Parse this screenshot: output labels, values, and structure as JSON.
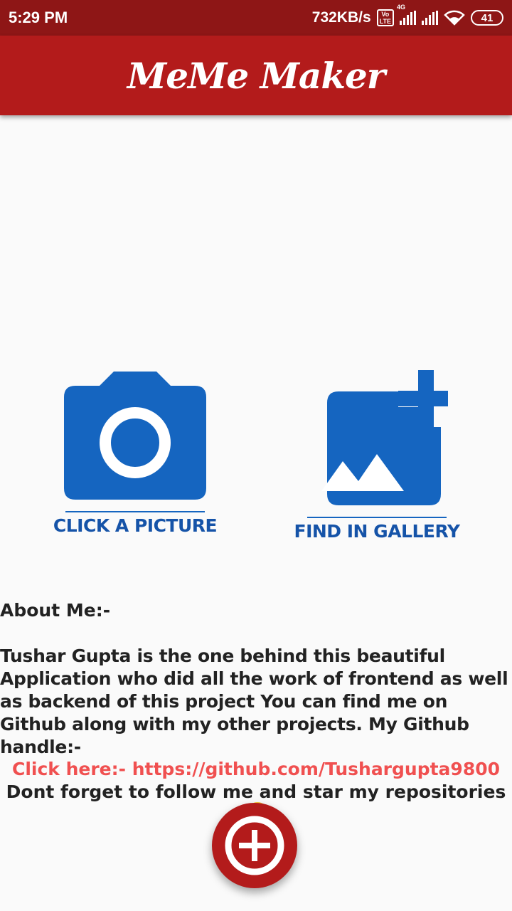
{
  "status_bar": {
    "time": "5:29 PM",
    "network_speed": "732KB/s",
    "volte_label": "Vo LTE",
    "network_type": "4G",
    "battery_level": "41"
  },
  "app_bar": {
    "title": "MeMe Maker"
  },
  "actions": {
    "camera_label": "CLICK A PICTURE",
    "gallery_label": "FIND IN GALLERY"
  },
  "about": {
    "heading": "About Me:-",
    "body": "Tushar Gupta is the one behind this beautiful Application who did all the work of frontend as well as backend of this project You can find me on Github along with my other projects. My Github handle:-",
    "link_text": "Click here:- https://github.com/Tushargupta9800",
    "follow_text": "Dont forget to follow me and star my repositories"
  },
  "colors": {
    "status_bar": "#8e1616",
    "app_bar": "#b31b1b",
    "icon_blue": "#1565c0",
    "link_red": "#f05050",
    "fab": "#b31b1b"
  },
  "icons": {
    "camera": "camera-icon",
    "gallery": "add-photo-icon",
    "fab": "add-circle-icon",
    "emoji": "winking-face-icon"
  }
}
